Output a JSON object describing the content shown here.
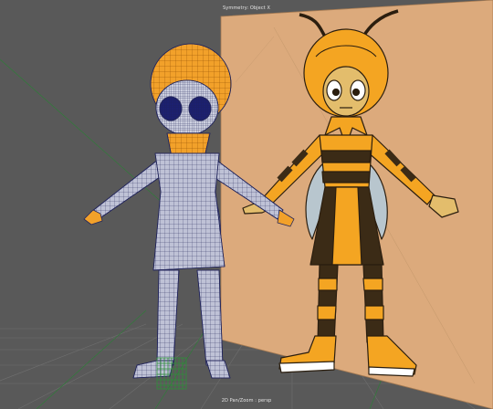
{
  "viewport": {
    "header_label": "Symmetry: Object X",
    "footer_label": "2D Pan/Zoom : persp"
  },
  "colors": {
    "background": "#595959",
    "reference_card": "#dcaa7c",
    "mesh_fill": "#bfc2d6",
    "mesh_wire": "#27295f",
    "skin_shade": "#e8941a",
    "bee_yellow": "#f4a522",
    "bee_dark": "#3b2b16",
    "wing": "#b8c6ce",
    "grid_line": "#6f6f6f",
    "axis_green": "#2f8f3a"
  },
  "objects": [
    {
      "name": "wireframe-bee-girl-model"
    },
    {
      "name": "reference-image-plane"
    },
    {
      "name": "ground-grid"
    },
    {
      "name": "selected-object-locator"
    }
  ]
}
